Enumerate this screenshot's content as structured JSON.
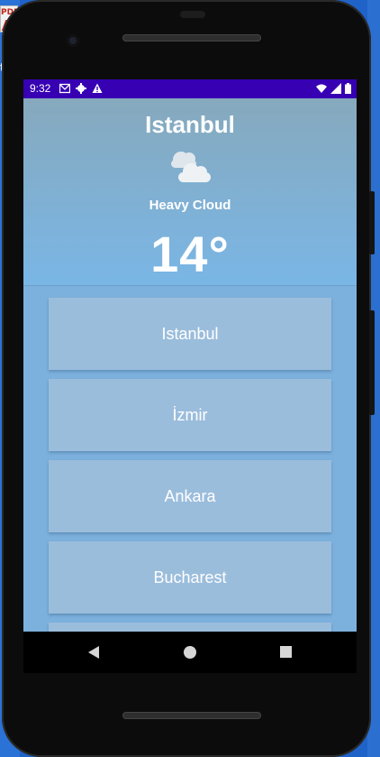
{
  "desktop": {
    "file_icon_label": "PDF",
    "partial_label": "te"
  },
  "status_bar": {
    "time": "9:32",
    "icons_left": [
      "gmail-icon",
      "settings-icon",
      "warning-icon"
    ],
    "icons_right": [
      "wifi-icon",
      "signal-icon",
      "battery-icon"
    ],
    "background": "#3700b3"
  },
  "weather": {
    "city": "Istanbul",
    "condition": "Heavy Cloud",
    "temperature": "14°",
    "icon": "heavy-cloud-icon"
  },
  "cities": [
    {
      "name": "Istanbul"
    },
    {
      "name": "İzmir"
    },
    {
      "name": "Ankara"
    },
    {
      "name": "Bucharest"
    }
  ],
  "nav_bar": {
    "buttons": [
      "back-button",
      "home-button",
      "recents-button"
    ]
  },
  "colors": {
    "card": "#9bbddc",
    "list_bg": "#7db1dd",
    "hero_top": "#86a9bd",
    "hero_bottom": "#7ab6e6"
  }
}
